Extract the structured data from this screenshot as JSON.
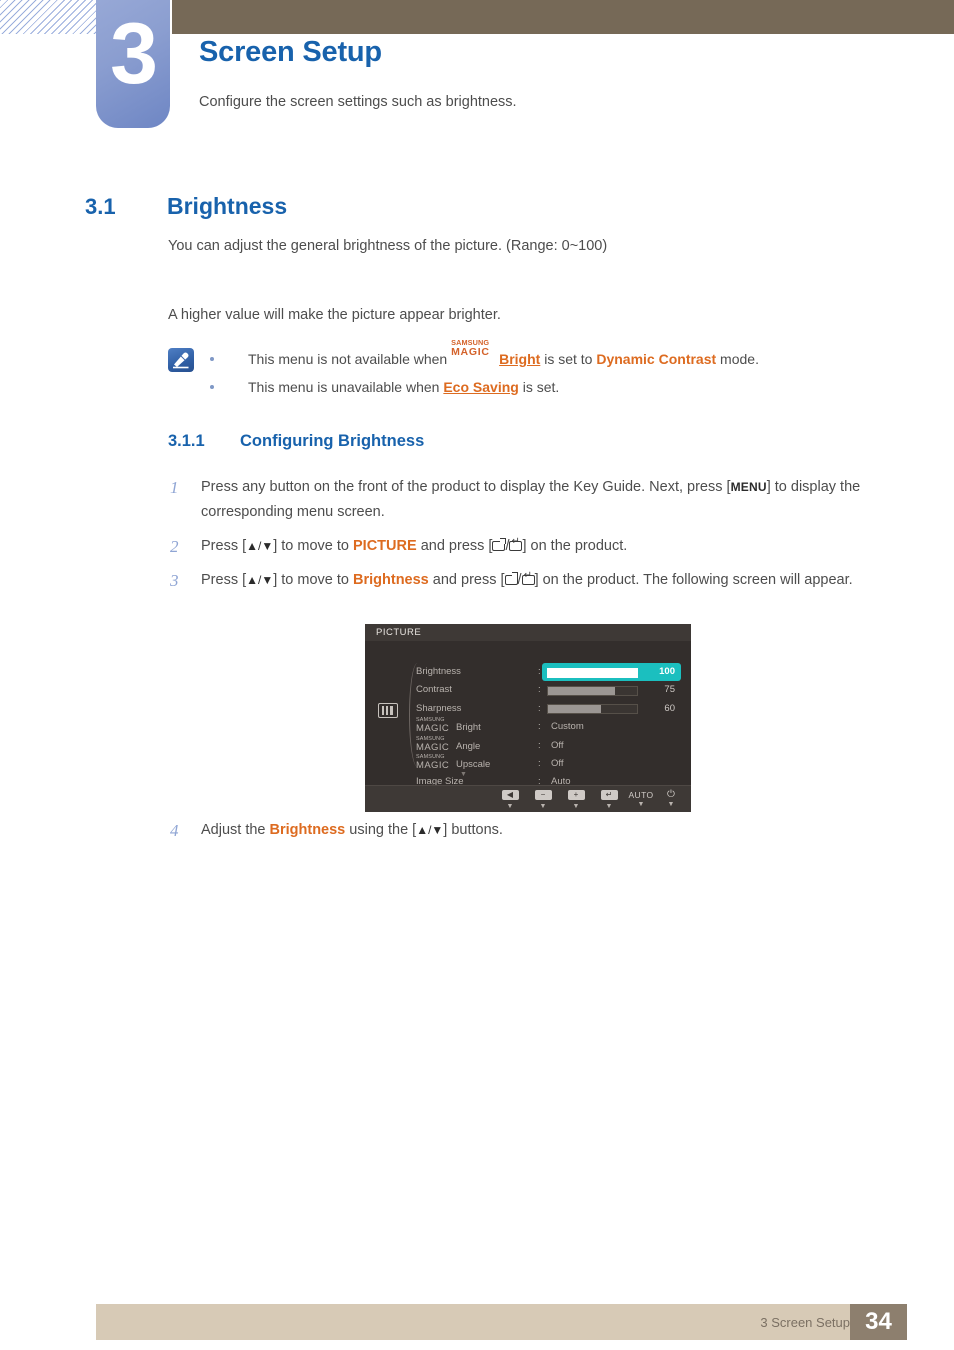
{
  "chapter": {
    "number": "3",
    "title": "Screen Setup",
    "subtitle": "Configure the screen settings such as brightness."
  },
  "section": {
    "number": "3.1",
    "title": "Brightness",
    "paragraph1": "You can adjust the general brightness of the picture. (Range: 0~100)",
    "paragraph2": "A higher value will make the picture appear brighter."
  },
  "note": {
    "icon": "note-pen-icon",
    "bullets": [
      {
        "prefix": "This menu is not available when ",
        "magic_top": "SAMSUNG",
        "magic_bottom": "MAGIC",
        "magic_word": "Bright",
        "middle": " is set to ",
        "highlight": "Dynamic Contrast",
        "suffix": " mode."
      },
      {
        "prefix": "This menu is unavailable when ",
        "highlight": "Eco Saving",
        "suffix": " is set."
      }
    ]
  },
  "subsection": {
    "number": "3.1.1",
    "title": "Configuring Brightness"
  },
  "steps": [
    {
      "number": "1",
      "t1": "Press any button on the front of the product to display the Key Guide. Next, press [",
      "kbd": "MENU",
      "t2": "] to display the corresponding menu screen."
    },
    {
      "number": "2",
      "t1": "Press [",
      "arrows": "▲/▼",
      "t2": "] to move to ",
      "target": "PICTURE",
      "t3": " and press [",
      "t4": "] on the product."
    },
    {
      "number": "3",
      "t1": "Press [",
      "arrows": "▲/▼",
      "t2": "] to move to ",
      "target": "Brightness",
      "t3": " and press [",
      "t4": "] on the product. The following screen will appear."
    },
    {
      "number": "4",
      "t1": "Adjust the ",
      "target": "Brightness",
      "t2": " using the [",
      "arrows": "▲/▼",
      "t3": "] buttons."
    }
  ],
  "osd": {
    "title": "PICTURE",
    "category_icon": "picture-bars-icon",
    "scroll_down_indicator": "▼",
    "rows": [
      {
        "label": "Brightness",
        "colon": ":",
        "type": "slider",
        "value": "100",
        "fill_percent": 100,
        "highlighted": true
      },
      {
        "label": "Contrast",
        "colon": ":",
        "type": "slider",
        "value": "75",
        "fill_percent": 75,
        "highlighted": false
      },
      {
        "label": "Sharpness",
        "colon": ":",
        "type": "slider",
        "value": "60",
        "fill_percent": 60,
        "highlighted": false
      },
      {
        "label": "Bright",
        "colon": ":",
        "type": "text",
        "magic_top": "SAMSUNG",
        "magic_bottom": "MAGIC",
        "value": "Custom",
        "highlighted": false
      },
      {
        "label": "Angle",
        "colon": ":",
        "type": "text",
        "magic_top": "SAMSUNG",
        "magic_bottom": "MAGIC",
        "value": "Off",
        "highlighted": false
      },
      {
        "label": "Upscale",
        "colon": ":",
        "type": "text",
        "magic_top": "SAMSUNG",
        "magic_bottom": "MAGIC",
        "value": "Off",
        "highlighted": false
      },
      {
        "label": "Image Size",
        "colon": ":",
        "type": "text",
        "value": "Auto",
        "highlighted": false
      }
    ],
    "footer_buttons": [
      {
        "icon": "back-arrow-icon",
        "glyph": "◀",
        "caption": "▼"
      },
      {
        "icon": "minus-icon",
        "glyph": "−",
        "caption": "▼"
      },
      {
        "icon": "plus-icon",
        "glyph": "+",
        "caption": "▼"
      },
      {
        "icon": "enter-icon",
        "glyph": "↵",
        "caption": "▼"
      },
      {
        "icon": "auto-label",
        "glyph": "AUTO",
        "caption": "▼"
      },
      {
        "icon": "power-icon",
        "glyph": "⏻",
        "caption": "▼"
      }
    ],
    "colors": {
      "background": "#332e2c",
      "title_bar": "#3e3936",
      "highlight": "#1bbfbf",
      "bar_fill": "#9b9693"
    }
  },
  "footer": {
    "text": "3 Screen Setup",
    "page": "34"
  },
  "colors": {
    "heading_blue": "#1862ac",
    "accent_orange": "#dd6b20",
    "top_bar_brown": "#766957",
    "footer_beige": "#d7cab6",
    "footer_page_brown": "#8d7f6e"
  }
}
